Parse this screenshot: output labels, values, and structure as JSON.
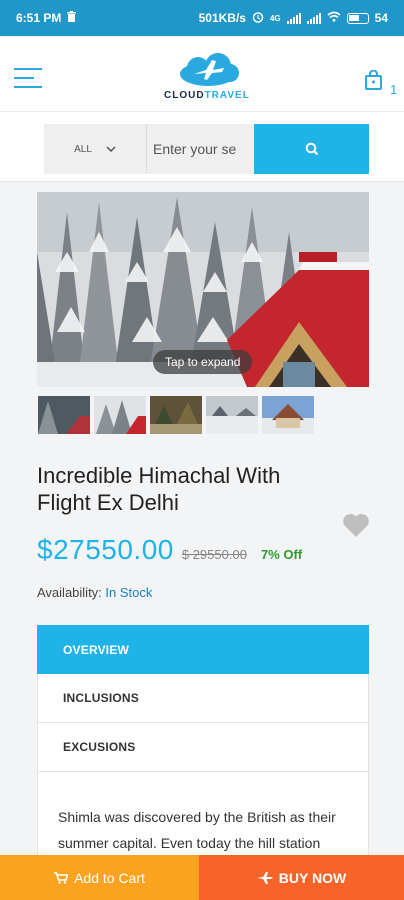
{
  "status_bar": {
    "time": "6:51 PM",
    "speed": "501KB/s",
    "network": "4G",
    "battery": "54"
  },
  "header": {
    "logo_primary": "CLOUD",
    "logo_accent": "TRAVEL",
    "cart_count": "1"
  },
  "search": {
    "category": "ALL",
    "placeholder": "Enter your se"
  },
  "gallery": {
    "tap_label": "Tap to expand",
    "thumbnail_count": 5
  },
  "product": {
    "title": "Incredible Himachal With Flight Ex Delhi",
    "price": "$27550.00",
    "old_price": "$ 29550.00",
    "discount": "7% Off",
    "availability_label": "Availability:",
    "availability_value": "In Stock"
  },
  "tabs": [
    {
      "label": "OVERVIEW",
      "active": true
    },
    {
      "label": "INCLUSIONS",
      "active": false
    },
    {
      "label": "EXCUSIONS",
      "active": false
    }
  ],
  "description": "Shimla was discovered by the British as their summer capital. Even today the hill station",
  "bottom_bar": {
    "add_to_cart": "Add to Cart",
    "buy_now": "BUY NOW"
  },
  "colors": {
    "status_bar": "#2196c9",
    "accent": "#1fb3e8",
    "cart_button": "#fba321",
    "buy_button": "#f7642a",
    "discount": "#2e9b2e"
  }
}
